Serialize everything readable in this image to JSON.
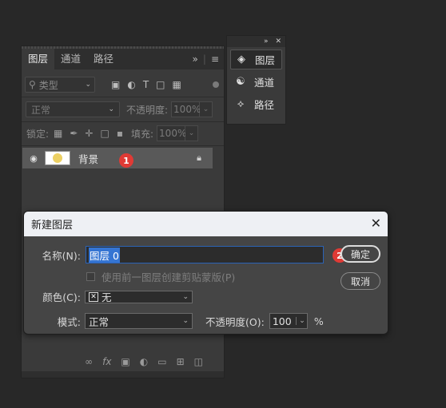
{
  "layers_panel": {
    "tabs": [
      {
        "label": "图层",
        "active": true
      },
      {
        "label": "通道",
        "active": false
      },
      {
        "label": "路径",
        "active": false
      }
    ],
    "filter_placeholder": "类型",
    "blend_mode": "正常",
    "opacity_label": "不透明度:",
    "opacity_value": "100%",
    "lock_label": "锁定:",
    "fill_label": "填充:",
    "fill_value": "100%",
    "layer": {
      "name": "背景",
      "thumbnail_color": "#ecd063"
    },
    "badge_1": "1"
  },
  "collapsed_panel": {
    "items": [
      {
        "label": "图层",
        "icon": "layers-icon"
      },
      {
        "label": "通道",
        "icon": "channels-icon"
      },
      {
        "label": "路径",
        "icon": "paths-icon"
      }
    ]
  },
  "dialog": {
    "title": "新建图层",
    "name_label": "名称(N):",
    "name_value": "图层 0",
    "ok_label": "确定",
    "cancel_label": "取消",
    "clip_label": "使用前一图层创建剪贴蒙版(P)",
    "color_label": "颜色(C):",
    "color_value": "无",
    "mode_label": "模式:",
    "mode_value": "正常",
    "opacity_label": "不透明度(O):",
    "opacity_value": "100",
    "opacity_unit": "%",
    "badge_2": "2"
  },
  "colors": {
    "accent": "#3575d3",
    "badge": "#e03a35",
    "selected_row": "#595959"
  }
}
